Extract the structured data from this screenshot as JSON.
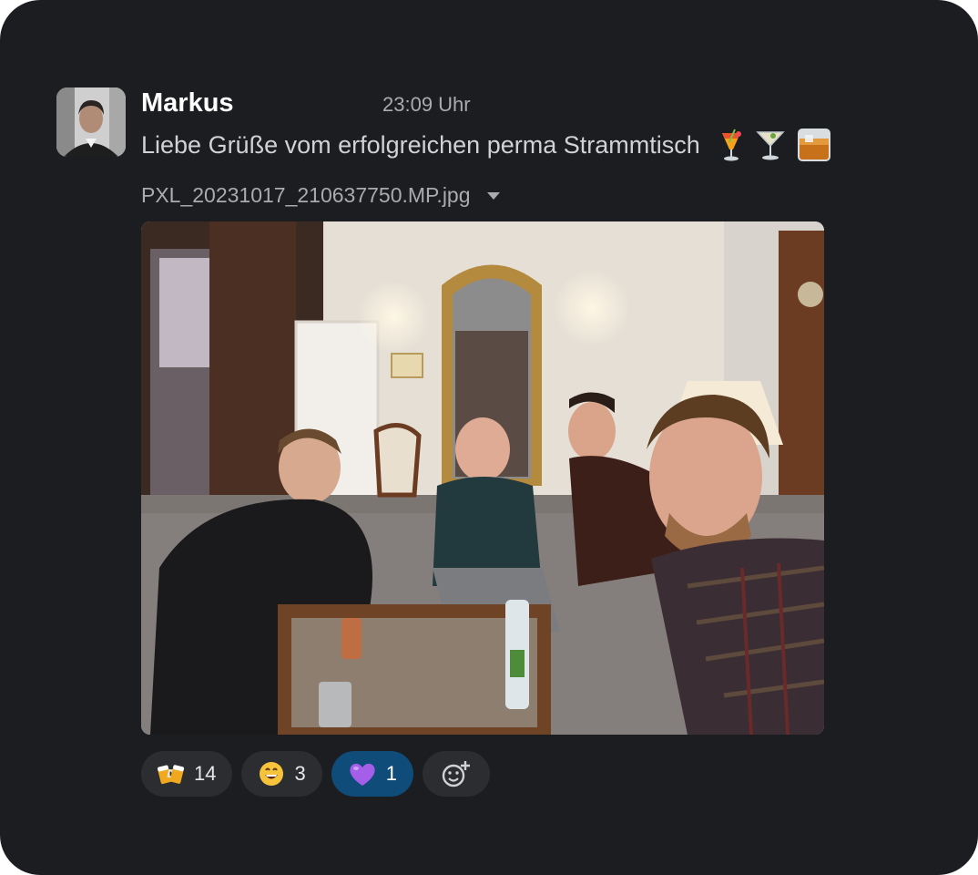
{
  "message": {
    "author": "Markus",
    "time": "23:09 Uhr",
    "text": "Liebe Grüße vom erfolgreichen perma Strammtisch",
    "text_emojis": [
      "tropical-drink-emoji",
      "cocktail-glass-emoji",
      "tumbler-glass-emoji"
    ]
  },
  "attachment": {
    "filename": "PXL_20231017_210637750.MP.jpg"
  },
  "reactions": [
    {
      "emoji": "clinking-beer-mugs-emoji",
      "count": "14",
      "active": false
    },
    {
      "emoji": "grinning-face-emoji",
      "count": "3",
      "active": false
    },
    {
      "emoji": "purple-heart-emoji",
      "count": "1",
      "active": true
    }
  ],
  "colors": {
    "background": "#1b1d21",
    "text": "#d1d2d3",
    "muted": "#ababad",
    "reaction_pill": "#2c2d31",
    "reaction_active": "#0f4c7a"
  }
}
